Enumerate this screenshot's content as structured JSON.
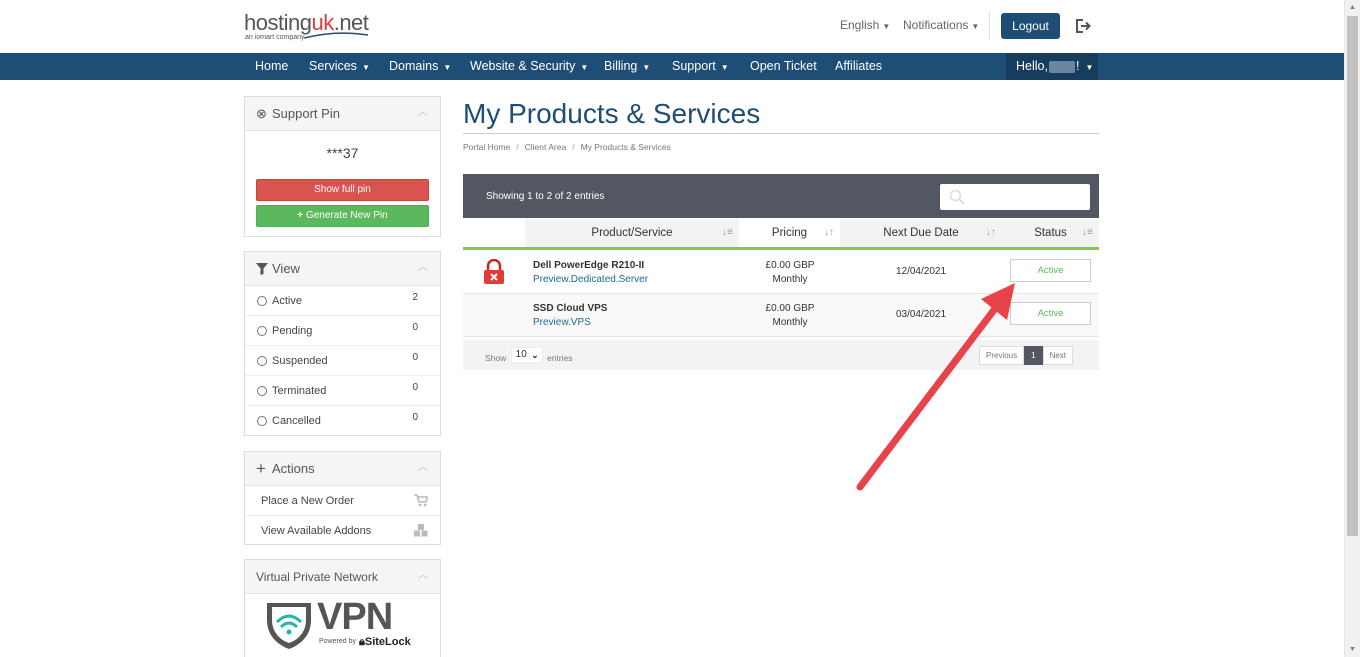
{
  "header": {
    "logo": {
      "brand_main": "hosting",
      "brand_accent": "uk",
      "brand_tld": ".net",
      "tagline": "an iomart company"
    },
    "language": "English",
    "notifications": "Notifications",
    "logout": "Logout"
  },
  "nav": {
    "items": [
      {
        "label": "Home",
        "has_caret": false
      },
      {
        "label": "Services",
        "has_caret": true
      },
      {
        "label": "Domains",
        "has_caret": true
      },
      {
        "label": "Website & Security",
        "has_caret": true
      },
      {
        "label": "Billing",
        "has_caret": true
      },
      {
        "label": "Support",
        "has_caret": true
      },
      {
        "label": "Open Ticket",
        "has_caret": false
      },
      {
        "label": "Affiliates",
        "has_caret": false
      }
    ],
    "hello_prefix": "Hello,",
    "hello_suffix": "!"
  },
  "sidebar": {
    "support_pin": {
      "title": "Support Pin",
      "pin": "***37",
      "show_full_pin": "Show full pin",
      "generate_new_pin": "Generate New Pin"
    },
    "view": {
      "title": "View",
      "filters": [
        {
          "label": "Active",
          "count": "2"
        },
        {
          "label": "Pending",
          "count": "0"
        },
        {
          "label": "Suspended",
          "count": "0"
        },
        {
          "label": "Terminated",
          "count": "0"
        },
        {
          "label": "Cancelled",
          "count": "0"
        }
      ]
    },
    "actions": {
      "title": "Actions",
      "items": [
        {
          "label": "Place a New Order",
          "icon": "cart-icon"
        },
        {
          "label": "View Available Addons",
          "icon": "cubes-icon"
        }
      ]
    },
    "vpn": {
      "title": "Virtual Private Network",
      "logo_text": "VPN",
      "powered_by": "Powered by",
      "sitelock": "SiteLock"
    }
  },
  "main": {
    "title": "My Products & Services",
    "breadcrumb": [
      "Portal Home",
      "Client Area",
      "My Products & Services"
    ],
    "table": {
      "showing": "Showing 1 to 2 of 2 entries",
      "columns": [
        "Product/Service",
        "Pricing",
        "Next Due Date",
        "Status"
      ],
      "rows": [
        {
          "product": "Dell PowerEdge R210-II",
          "domain": "Preview.Dedicated.Server",
          "price": "£0.00 GBP",
          "cycle": "Monthly",
          "due": "12/04/2021",
          "status": "Active",
          "locked": true
        },
        {
          "product": "SSD Cloud VPS",
          "domain": "Preview.VPS",
          "price": "£0.00 GBP",
          "cycle": "Monthly",
          "due": "03/04/2021",
          "status": "Active",
          "locked": false
        }
      ],
      "show_label": "Show",
      "page_length": "10",
      "entries_label": "entries",
      "pager": {
        "previous": "Previous",
        "current": "1",
        "next": "Next"
      }
    }
  },
  "colors": {
    "nav_bg": "#1e4d75",
    "accent_green": "#8cc63f",
    "danger": "#d9534f",
    "success": "#5cb85c",
    "annotation_arrow": "#e8424a"
  }
}
